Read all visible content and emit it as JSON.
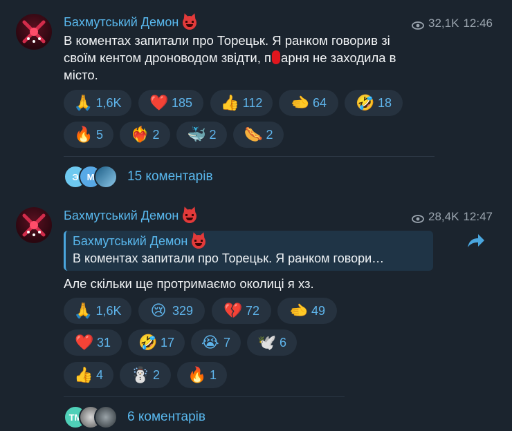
{
  "post1": {
    "channel": "Бахмутський Демон",
    "views": "32,1K",
    "time": "12:46",
    "text_line1": "В коментах запитали про Торецьк. Я ранком говорив зі",
    "text_line2": "своїм кентом дроноводом звідти, п",
    "text_line2b": "арня не заходила в",
    "text_line3": "місто.",
    "reactions": [
      {
        "icon": "pray-icon",
        "emoji": "🙏",
        "count": "1,6K"
      },
      {
        "icon": "heart-icon",
        "emoji": "❤️",
        "count": "185"
      },
      {
        "icon": "thumbs-up-icon",
        "emoji": "👍",
        "count": "112"
      },
      {
        "icon": "pointing-hand-icon",
        "emoji": "🫲",
        "count": "64"
      },
      {
        "icon": "rofl-icon",
        "emoji": "🤣",
        "count": "18"
      },
      {
        "icon": "fire-icon",
        "emoji": "🔥",
        "count": "5"
      },
      {
        "icon": "heart-on-fire-icon",
        "emoji": "❤️‍🔥",
        "count": "2"
      },
      {
        "icon": "whale-icon",
        "emoji": "🐳",
        "count": "2"
      },
      {
        "icon": "hotdog-icon",
        "emoji": "🌭",
        "count": "2"
      }
    ],
    "comments": "15 коментарів",
    "comment_avatars": [
      "Э",
      "М",
      ""
    ]
  },
  "post2": {
    "channel": "Бахмутський Демон",
    "views": "28,4K",
    "time": "12:47",
    "quote_title": "Бахмутський Демон",
    "quote_text": "В коментах запитали про Торецьк. Я ранком говори…",
    "text": "Але скільки ще протримаємо околиці я хз.",
    "reactions": [
      {
        "icon": "pray-icon",
        "emoji": "🙏",
        "count": "1,6K"
      },
      {
        "icon": "crying-face-icon",
        "emoji": "😢",
        "count": "329"
      },
      {
        "icon": "broken-heart-icon",
        "emoji": "💔",
        "count": "72"
      },
      {
        "icon": "pointing-hand-icon",
        "emoji": "🫲",
        "count": "49"
      },
      {
        "icon": "heart-icon",
        "emoji": "❤️",
        "count": "31"
      },
      {
        "icon": "rofl-icon",
        "emoji": "🤣",
        "count": "17"
      },
      {
        "icon": "sobbing-face-icon",
        "emoji": "😭",
        "count": "7"
      },
      {
        "icon": "dove-icon",
        "emoji": "🕊️",
        "count": "6"
      },
      {
        "icon": "thumbs-up-icon",
        "emoji": "👍",
        "count": "4"
      },
      {
        "icon": "snowman-icon",
        "emoji": "☃️",
        "count": "2"
      },
      {
        "icon": "fire-icon",
        "emoji": "🔥",
        "count": "1"
      }
    ],
    "comments": "6 коментарів",
    "comment_avatars": [
      "TM",
      "",
      ""
    ]
  },
  "colors": {
    "background": "#1b242e",
    "accent": "#59b8ee",
    "reaction_bg": "#26323f",
    "muted": "#9aa4ae"
  }
}
